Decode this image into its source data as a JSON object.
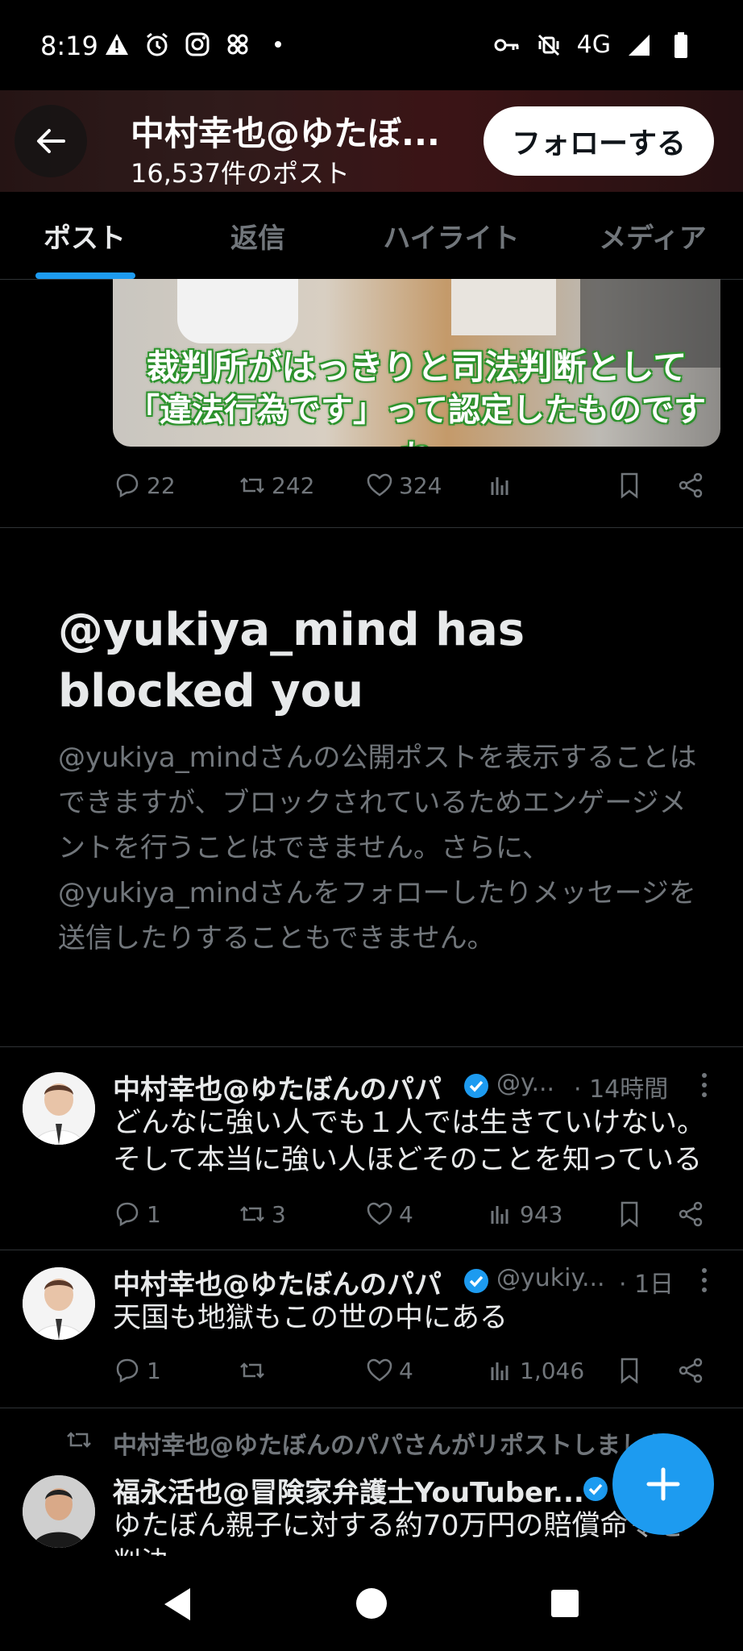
{
  "status_bar": {
    "time": "8:19",
    "left_icons": [
      "warning-icon",
      "alarm-icon",
      "instagram-icon",
      "threads-icon",
      "dot-icon"
    ],
    "right_icons": [
      "key-icon",
      "vibrate-off-icon",
      "signal-icon",
      "battery-icon"
    ],
    "network": "4G"
  },
  "header": {
    "title": "中村幸也@ゆたぼ...",
    "post_count": "16,537件のポスト",
    "follow_label": "フォローする"
  },
  "tabs": [
    {
      "label": "ポスト",
      "active": true
    },
    {
      "label": "返信",
      "active": false
    },
    {
      "label": "ハイライト",
      "active": false
    },
    {
      "label": "メディア",
      "active": false
    }
  ],
  "post1": {
    "caption_line1": "裁判所がはっきりと司法判断として",
    "caption_line2": "「違法行為です」って認定したものですね",
    "replies": "22",
    "reposts": "242",
    "likes": "324"
  },
  "blocked": {
    "title": "@yukiya_mind has blocked you",
    "description": "@yukiya_mindさんの公開ポストを表示することはできますが、ブロックされているためエンゲージメントを行うことはできません。さらに、@yukiya_mindさんをフォローしたりメッセージを送信したりすることもできません。"
  },
  "tweets": [
    {
      "name": "中村幸也@ゆたぼんのパパ",
      "handle": "@y...",
      "time": "· 14時間",
      "text_line1": "どんなに強い人でも１人では生きていけない。",
      "text_line2": "そして本当に強い人ほどそのことを知っている",
      "replies": "1",
      "reposts": "3",
      "likes": "4",
      "views": "943"
    },
    {
      "name": "中村幸也@ゆたぼんのパパ",
      "handle": "@yukiy...",
      "time": "· 1日",
      "text_line1": "天国も地獄もこの世の中にある",
      "replies": "1",
      "reposts": "",
      "likes": "4",
      "views": "1,046"
    }
  ],
  "repost_item": {
    "repost_notice": "中村幸也@ゆたぼんのパパさんがリポストしました",
    "name": "福永活也@冒険家弁護士YouTuber...",
    "text_line1": "ゆたぼん親子に対する約70万円の賠償命令を",
    "text_line2": "判決"
  },
  "colors": {
    "accent": "#1d9bf0",
    "background": "#000000",
    "muted": "#71767b"
  }
}
